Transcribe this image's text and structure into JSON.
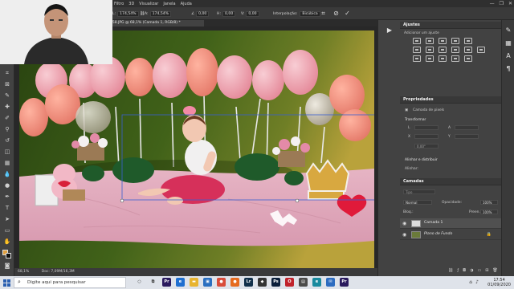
{
  "menu": [
    "Filtro",
    "3D",
    "Visualizar",
    "Janela",
    "Ajuda"
  ],
  "window_controls": [
    "—",
    "❐",
    "✕"
  ],
  "options": {
    "w_label": "L:",
    "w_value": "174,54%",
    "h_label": "A:",
    "h_value": "174,54%",
    "angle_value": "0,00",
    "h_skew_label": "H:",
    "h_skew_value": "0,00",
    "v_skew_label": "V:",
    "v_skew_value": "0,00",
    "interp_label": "Interpolação:",
    "interp_value": "Bicúbica"
  },
  "doc_tab": "758.JPG @ 68,1% (Camada 1, RGB/8) *",
  "status": {
    "zoom": "68,1%",
    "doc_size": "Doc: 7,09M/16,3M"
  },
  "panels": {
    "ajustes_title": "Ajustes",
    "ajustes_subtitle": "Adicionar um ajuste",
    "propriedades_title": "Propriedades",
    "prop_item": "Camada de pixels",
    "transformar": "Transformar",
    "transform_fields": [
      "L",
      "A",
      "X",
      "Y"
    ],
    "angle": "0,00°",
    "alinhar": "Alinhar e distribuir",
    "alinhar_sub": "Alinhar:",
    "camadas_title": "Camadas",
    "search_placeholder": "Tipo",
    "blend_mode": "Normal",
    "opacity_label": "Opacidade:",
    "opacity_value": "100%",
    "lock_label": "Bloq.:",
    "fill_label": "Preen.:",
    "fill_value": "100%",
    "layers": [
      {
        "name": "Camada 1",
        "italic": false
      },
      {
        "name": "Plano de Fundo",
        "italic": true
      }
    ]
  },
  "taskbar": {
    "search_placeholder": "Digite aqui para pesquisar",
    "apps": [
      {
        "icon": "cortana-icon",
        "label": "○",
        "color": "#dfe3ea"
      },
      {
        "icon": "task-view-icon",
        "label": "⧉",
        "color": "#dfe3ea"
      },
      {
        "icon": "premiere-icon",
        "label": "Pr",
        "color": "#2a1a5e"
      },
      {
        "icon": "edge-icon",
        "label": "e",
        "color": "#1f6fd0"
      },
      {
        "icon": "explorer-icon",
        "label": "▬",
        "color": "#e8b430"
      },
      {
        "icon": "photos-icon",
        "label": "▣",
        "color": "#2a6fc0"
      },
      {
        "icon": "chrome-icon",
        "label": "●",
        "color": "#d94c3a"
      },
      {
        "icon": "firefox-icon",
        "label": "●",
        "color": "#e66b1f"
      },
      {
        "icon": "lightroom-icon",
        "label": "Lr",
        "color": "#12304a"
      },
      {
        "icon": "app-icon",
        "label": "◆",
        "color": "#333333"
      },
      {
        "icon": "photoshop-icon",
        "label": "Ps",
        "color": "#0a1e3a"
      },
      {
        "icon": "opera-icon",
        "label": "O",
        "color": "#c0232c"
      },
      {
        "icon": "store-icon",
        "label": "▤",
        "color": "#4a4a4a"
      },
      {
        "icon": "edge-new-icon",
        "label": "e",
        "color": "#1a8a9e"
      },
      {
        "icon": "mail-icon",
        "label": "✉",
        "color": "#2d6cc0"
      },
      {
        "icon": "premiere2-icon",
        "label": "Pr",
        "color": "#2a1a5e"
      }
    ],
    "time": "17:54",
    "date": "01/09/2020"
  }
}
